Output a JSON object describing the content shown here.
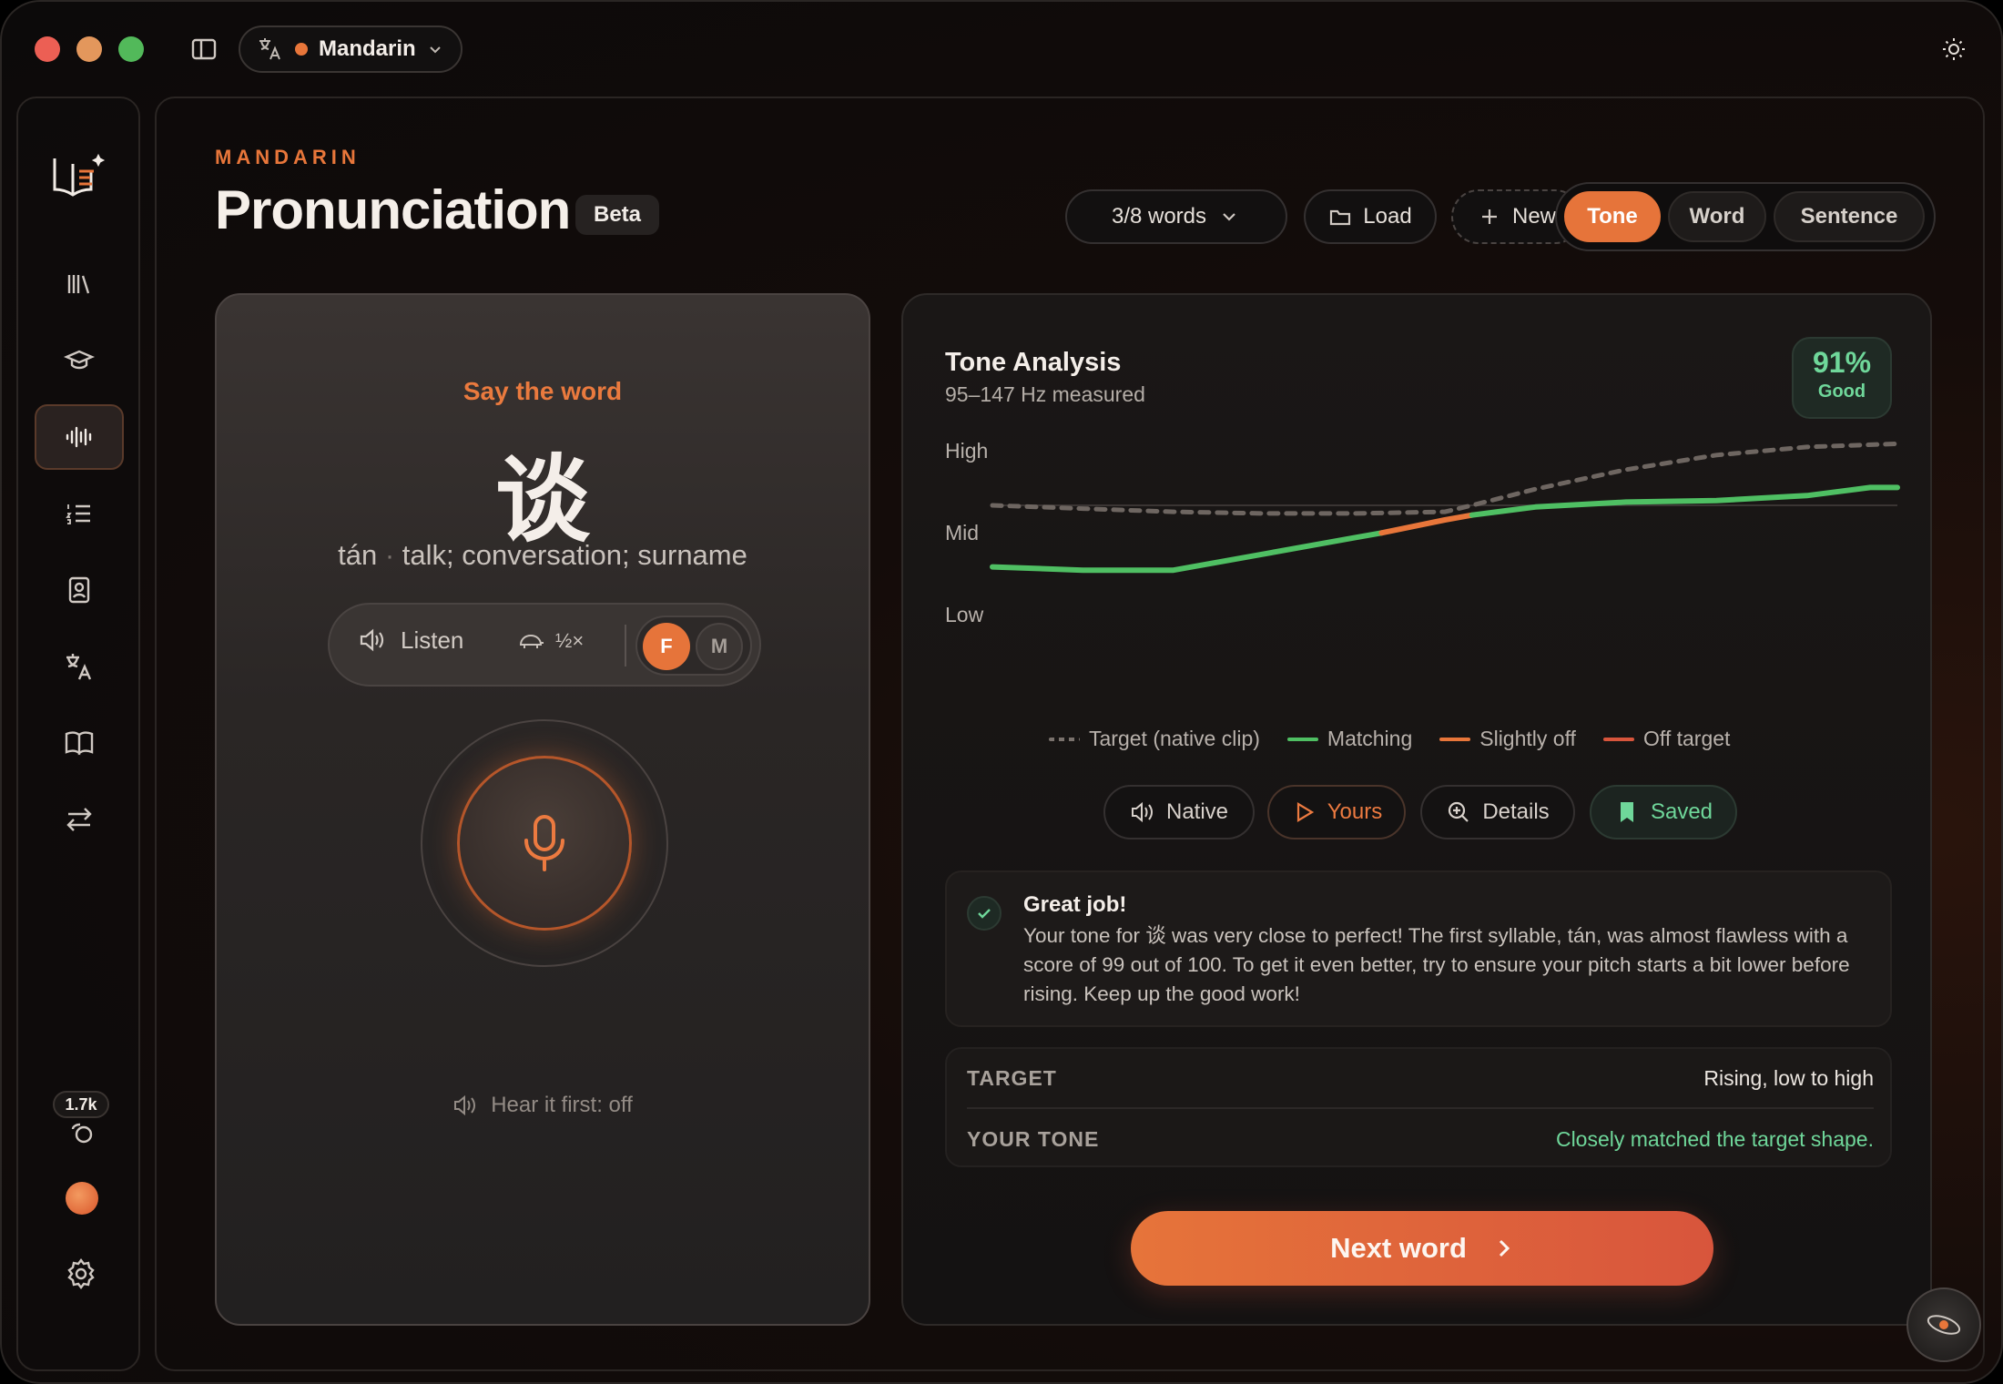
{
  "titlebar": {
    "language": "Mandarin"
  },
  "sidebar": {
    "xp_count": "1.7k"
  },
  "header": {
    "eyebrow": "MANDARIN",
    "title": "Pronunciation",
    "badge": "Beta",
    "progress_label": "3/8 words",
    "load_label": "Load",
    "new_label": "New",
    "modes": [
      "Tone",
      "Word",
      "Sentence"
    ],
    "active_mode": "Tone"
  },
  "say_card": {
    "prompt": "Say the word",
    "character": "谈",
    "pinyin": "tán",
    "separator": "·",
    "meaning": "talk; conversation; surname",
    "listen_label": "Listen",
    "speed_label": "½×",
    "voice_female": "F",
    "voice_male": "M",
    "hear_first": "Hear it first: off"
  },
  "tone_card": {
    "title": "Tone Analysis",
    "subtitle": "95–147 Hz measured",
    "score_percent": "91%",
    "score_word": "Good",
    "actions": {
      "native": "Native",
      "yours": "Yours",
      "details": "Details",
      "saved": "Saved"
    },
    "feedback": {
      "title": "Great job!",
      "body": "Your tone for 谈 was very close to perfect! The first syllable, tán, was almost flawless with a score of 99 out of 100. To get it even better, try to ensure your pitch starts a bit lower before rising. Keep up the good work!"
    },
    "meta": {
      "target_key": "TARGET",
      "target_value": "Rising, low to high",
      "your_key": "YOUR TONE",
      "your_value": "Closely matched the target shape."
    },
    "next_label": "Next word"
  },
  "chart_data": {
    "type": "line",
    "y_ticks": [
      "High",
      "Mid",
      "Low"
    ],
    "ylim": [
      0,
      1
    ],
    "xlim": [
      0,
      1
    ],
    "grid": "mid-line only",
    "legend": [
      "Target (native clip)",
      "Matching",
      "Slightly off",
      "Off target"
    ],
    "legend_placement": "bottom",
    "colors": {
      "target": "#6e6661",
      "matching": "#4fbf63",
      "slightly_off": "#e8763a",
      "off_target": "#d8553c",
      "midline": "#3a3533"
    },
    "series": [
      {
        "name": "Target (native clip)",
        "style": "dashed",
        "x": [
          0,
          0.1,
          0.2,
          0.3,
          0.4,
          0.5,
          0.53,
          0.6,
          0.7,
          0.8,
          0.9,
          1.0
        ],
        "y": [
          0.5,
          0.48,
          0.46,
          0.45,
          0.45,
          0.46,
          0.5,
          0.6,
          0.72,
          0.81,
          0.86,
          0.88
        ]
      },
      {
        "name": "Your pitch",
        "x": [
          0,
          0.1,
          0.2,
          0.3,
          0.4,
          0.43,
          0.5,
          0.53,
          0.6,
          0.7,
          0.8,
          0.9,
          0.97,
          1.0
        ],
        "y": [
          0.12,
          0.1,
          0.1,
          0.2,
          0.3,
          0.33,
          0.41,
          0.44,
          0.49,
          0.52,
          0.53,
          0.56,
          0.61,
          0.61
        ],
        "segments": [
          {
            "from": 0,
            "to": 0.43,
            "status": "matching"
          },
          {
            "from": 0.43,
            "to": 0.53,
            "status": "slightly_off"
          },
          {
            "from": 0.53,
            "to": 1.0,
            "status": "matching"
          }
        ]
      }
    ]
  }
}
